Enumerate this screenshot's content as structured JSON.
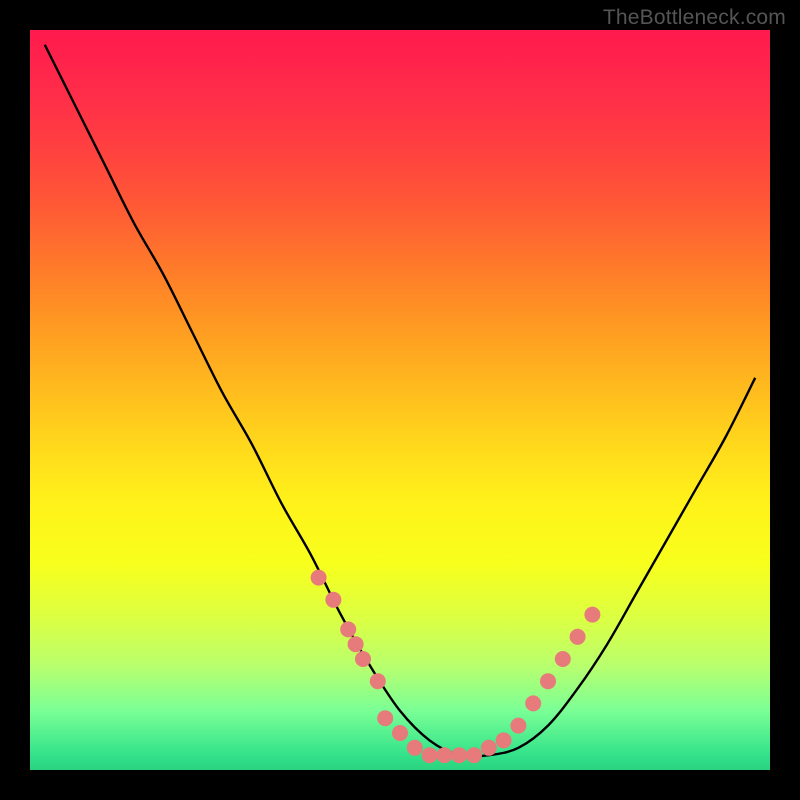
{
  "watermark": "TheBottleneck.com",
  "chart_data": {
    "type": "line",
    "title": "",
    "xlabel": "",
    "ylabel": "",
    "xlim": [
      0,
      100
    ],
    "ylim": [
      0,
      100
    ],
    "grid": false,
    "legend": false,
    "series": [
      {
        "name": "curve",
        "x": [
          2,
          6,
          10,
          14,
          18,
          22,
          26,
          30,
          34,
          38,
          42,
          46,
          50,
          54,
          58,
          62,
          66,
          70,
          74,
          78,
          82,
          86,
          90,
          94,
          98
        ],
        "y": [
          98,
          90,
          82,
          74,
          67,
          59,
          51,
          44,
          36,
          29,
          21,
          14,
          8,
          4,
          2,
          2,
          3,
          6,
          11,
          17,
          24,
          31,
          38,
          45,
          53
        ]
      }
    ],
    "marker_clusters": [
      {
        "name": "left-cluster",
        "x": [
          39,
          41,
          43,
          44,
          45,
          47
        ],
        "y": [
          26,
          23,
          19,
          17,
          15,
          12
        ]
      },
      {
        "name": "bottom-cluster",
        "x": [
          48,
          50,
          52,
          54,
          56,
          58,
          60,
          62,
          64,
          66
        ],
        "y": [
          7,
          5,
          3,
          2,
          2,
          2,
          2,
          3,
          4,
          6
        ]
      },
      {
        "name": "right-cluster",
        "x": [
          68,
          70,
          72,
          74,
          76
        ],
        "y": [
          9,
          12,
          15,
          18,
          21
        ]
      }
    ],
    "marker_color": "#e77a7a",
    "curve_color": "#000000"
  }
}
